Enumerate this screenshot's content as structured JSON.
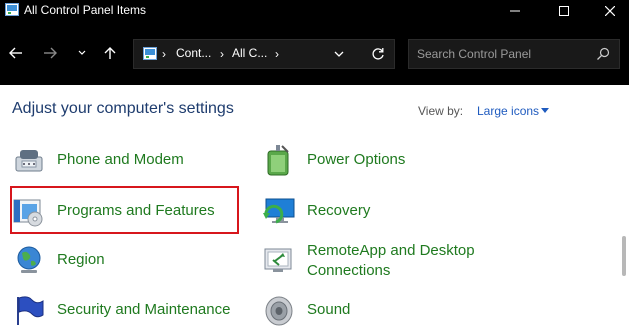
{
  "window": {
    "title": "All Control Panel Items"
  },
  "navigation": {
    "breadcrumbs": [
      "Cont...",
      "All C..."
    ],
    "search_placeholder": "Search Control Panel"
  },
  "main": {
    "heading": "Adjust your computer's settings",
    "view_by_label": "View by:",
    "view_by_value": "Large icons"
  },
  "items": [
    {
      "label": "Phone and Modem",
      "icon": "phone-modem-icon"
    },
    {
      "label": "Power Options",
      "icon": "power-options-icon"
    },
    {
      "label": "Programs and Features",
      "icon": "programs-features-icon",
      "highlighted": true
    },
    {
      "label": "Recovery",
      "icon": "recovery-icon"
    },
    {
      "label": "Region",
      "icon": "region-globe-icon"
    },
    {
      "label": "RemoteApp and Desktop Connections",
      "label_line1": "RemoteApp and Desktop",
      "label_line2": "Connections",
      "icon": "remoteapp-icon"
    },
    {
      "label": "Security and Maintenance",
      "icon": "security-flag-icon"
    },
    {
      "label": "Sound",
      "icon": "sound-icon"
    }
  ],
  "colors": {
    "titlebar_bg": "#000000",
    "heading": "#1e3c6e",
    "link_green": "#1f7a1f",
    "highlight_border": "#d7161c",
    "view_by_value": "#1f5bbf"
  }
}
